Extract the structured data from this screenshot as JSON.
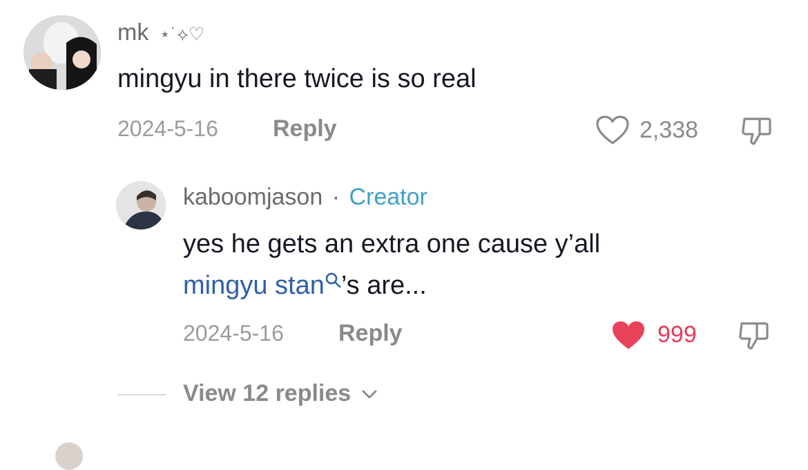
{
  "comment": {
    "username": "mk",
    "username_decoration": "⋆˙⟡♡",
    "text": "mingyu in there twice is so real",
    "date": "2024-5-16",
    "reply_label": "Reply",
    "like_count": "2,338",
    "liked": false
  },
  "reply": {
    "username": "kaboomjason",
    "separator": "·",
    "badge": "Creator",
    "text_line1": "yes he gets an extra one cause y’all",
    "link_text": "mingyu stan",
    "text_after_link": "’s are...",
    "date": "2024-5-16",
    "reply_label": "Reply",
    "like_count": "999",
    "liked": true
  },
  "view_replies": {
    "label": "View 12 replies"
  },
  "colors": {
    "liked_heart": "#e8435a",
    "creator_badge": "#3ea0c8",
    "link": "#2f5fa8"
  }
}
